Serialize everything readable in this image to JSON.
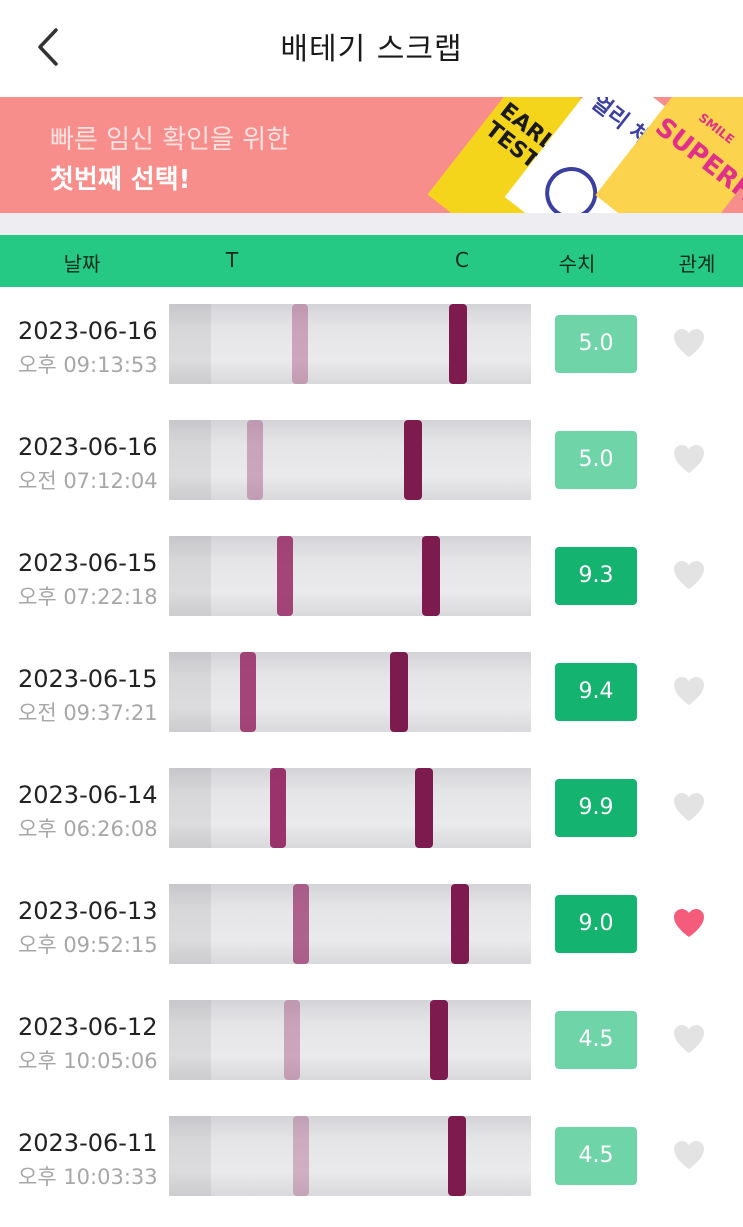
{
  "header": {
    "title": "배테기 스크랩",
    "back_icon": "chevron-left-icon"
  },
  "banner": {
    "line1": "빠른 임신 확인을 위한",
    "line2": "첫번째 선택!",
    "pkg1_text": "EARLY TESTER",
    "pkg2_text": "얼리 체크",
    "pkg3_small": "SMILE",
    "pkg3_text": "SUPERFA",
    "background": "#f88e8b"
  },
  "columns": {
    "date": "날짜",
    "t": "T",
    "c": "C",
    "value": "수치",
    "relation": "관계"
  },
  "colors": {
    "header_green": "#25c983",
    "badge_light": "#6fd5a8",
    "badge_dark": "#14b36f",
    "heart_off": "#e3e3e3",
    "heart_on": "#f55b7b",
    "control_line": "#7d1a4e"
  },
  "rows": [
    {
      "date": "2023-06-16",
      "time": "오후 09:13:53",
      "value": "5.0",
      "level": "low",
      "liked": false,
      "t_intensity": 0.35
    },
    {
      "date": "2023-06-16",
      "time": "오전 07:12:04",
      "value": "5.0",
      "level": "low",
      "liked": false,
      "t_intensity": 0.35
    },
    {
      "date": "2023-06-15",
      "time": "오후 07:22:18",
      "value": "9.3",
      "level": "high",
      "liked": false,
      "t_intensity": 0.85
    },
    {
      "date": "2023-06-15",
      "time": "오전 09:37:21",
      "value": "9.4",
      "level": "high",
      "liked": false,
      "t_intensity": 0.85
    },
    {
      "date": "2023-06-14",
      "time": "오후 06:26:08",
      "value": "9.9",
      "level": "high",
      "liked": false,
      "t_intensity": 0.95
    },
    {
      "date": "2023-06-13",
      "time": "오후 09:52:15",
      "value": "9.0",
      "level": "high",
      "liked": true,
      "t_intensity": 0.7
    },
    {
      "date": "2023-06-12",
      "time": "오후 10:05:06",
      "value": "4.5",
      "level": "low",
      "liked": false,
      "t_intensity": 0.35
    },
    {
      "date": "2023-06-11",
      "time": "오후 10:03:33",
      "value": "4.5",
      "level": "low",
      "liked": false,
      "t_intensity": 0.3
    }
  ]
}
